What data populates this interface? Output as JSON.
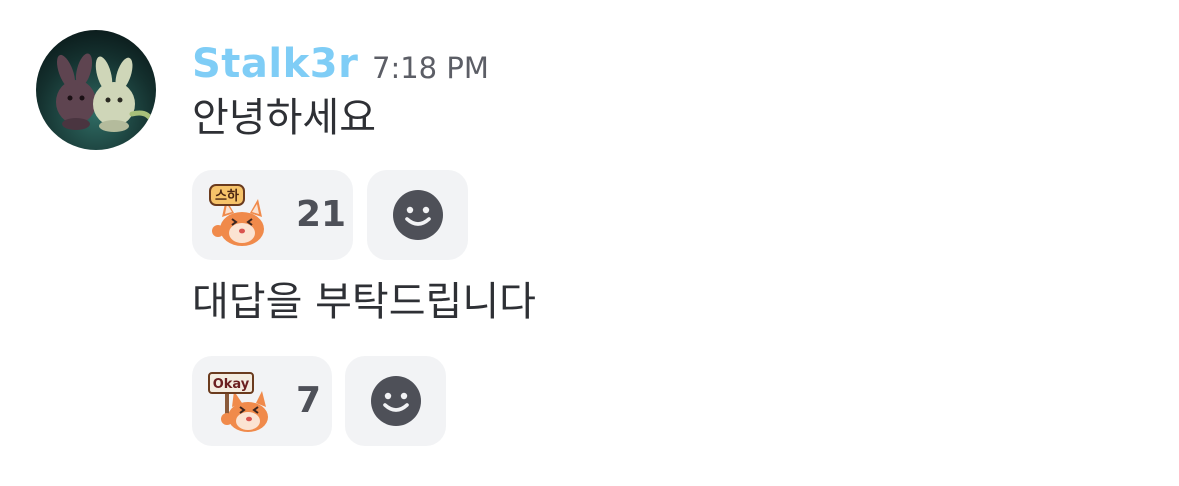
{
  "message_group": {
    "author": "Stalk3r",
    "timestamp": "7:18 PM",
    "author_color": "#7fcdf6",
    "messages": [
      {
        "text": "안녕하세요",
        "reaction": {
          "emoji_icon": "fox-sticker-seuha-emoji",
          "emoji_text": "스하",
          "count": "21"
        }
      },
      {
        "text": "대답을 부탁드립니다",
        "reaction": {
          "emoji_icon": "fox-sticker-okay-emoji",
          "emoji_text": "Okay",
          "count": "7"
        }
      }
    ],
    "add_reaction_icon": "smiley-add-reaction-icon"
  }
}
